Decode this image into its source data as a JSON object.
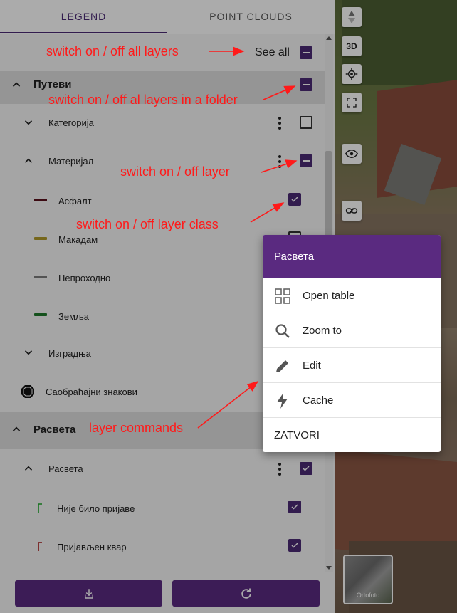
{
  "tabs": {
    "legend": "LEGEND",
    "point_clouds": "POINT CLOUDS"
  },
  "see_all": {
    "label": "See all"
  },
  "folders": [
    {
      "label": "Путеви",
      "layers": [
        {
          "label": "Категорија",
          "expanded": false
        },
        {
          "label": "Материјал",
          "expanded": true,
          "classes": [
            {
              "label": "Асфалт",
              "color": "#5a0f1c"
            },
            {
              "label": "Макадам",
              "color": "#b09a2a"
            },
            {
              "label": "Непроходно",
              "color": "#7d7d7d"
            },
            {
              "label": "Земља",
              "color": "#1f7a2a"
            }
          ]
        },
        {
          "label": "Изградња",
          "expanded": false
        },
        {
          "label": "Саобраћајни знакови",
          "icon": "stop-sign-icon"
        }
      ]
    },
    {
      "label": "Расвета",
      "layers": [
        {
          "label": "Расвета",
          "expanded": true,
          "classes": [
            {
              "label": "Није било пријаве",
              "icon": "lamp-green-icon",
              "color": "#1faa2a"
            },
            {
              "label": "Пријављен квар",
              "icon": "lamp-red-icon",
              "color": "#aa1a1a"
            }
          ]
        }
      ]
    }
  ],
  "menu": {
    "title": "Расвета",
    "items": [
      {
        "label": "Open table",
        "icon": "grid-icon"
      },
      {
        "label": "Zoom to",
        "icon": "search-icon"
      },
      {
        "label": "Edit",
        "icon": "pencil-icon"
      },
      {
        "label": "Cache",
        "icon": "lightning-icon"
      }
    ],
    "close_label": "ZATVORI"
  },
  "map": {
    "btn_3d": "3D",
    "basemap_label": "Ortofoto"
  },
  "annotations": {
    "all_layers": "switch on / off all layers",
    "folder": "switch on / off al layers in a folder",
    "layer": "switch on / off layer",
    "layer_class": "switch on / off layer class",
    "commands": "layer commands"
  },
  "colors": {
    "accent": "#5a2a80",
    "annotation": "#ff1a1a"
  }
}
